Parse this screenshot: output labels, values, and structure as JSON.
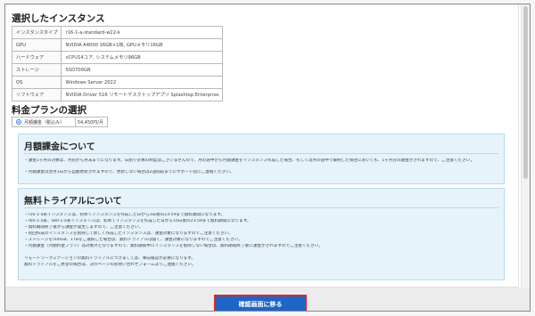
{
  "selected_instance": {
    "title": "選択したインスタンス",
    "rows": [
      {
        "key": "インスタンスタイプ",
        "value": "r16-1-a-standard-w22-k"
      },
      {
        "key": "GPU",
        "value": "NVIDIA A4000 16GB×1枚, GPUメモリ16GB"
      },
      {
        "key": "ハードウェア",
        "value": "vCPU14コア, システムメモリ96GB"
      },
      {
        "key": "ストレージ",
        "value": "SSD700GB"
      },
      {
        "key": "OS",
        "value": "Windows Server 2022"
      },
      {
        "key": "ソフトウェア",
        "value": "NVIDIA Driver 516 リモートデスクトップアプリ Splashtop Enterprise"
      }
    ]
  },
  "plan": {
    "title": "料金プランの選択",
    "option_label": "月額課金（税込み）",
    "option_price": "54,450円/月"
  },
  "monthly_box": {
    "title": "月額課金について",
    "lines": [
      "・課金1ヶ月の対象は、月初から月末までになります。日割り計算の制度はございませんので、月の途中から月額課金をインスタンス作成した場合、もしくは月の途中で解約した場合においても、1ヶ月分の課金がされますので、ご注意ください。",
      "・月額課金は翌月1日から自動更新されますので、更新しない場合は2週間前までにサポート宛にご連絡ください。"
    ]
  },
  "trial_box": {
    "title": "無料トライアルについて",
    "lines": [
      "・r16-1-a系インスタンスは、初めてインスタンスを作成した日から3日後の23:59まで無料期間になります。",
      "・r60-1-a系、s80-1-a系インスタンスは、初めてインスタンスを作成した日から10日後の23:59まで無料期間になります。",
      "・無料期間終了後から課金が発生しますので、ご注意ください。",
      "・初回作成のインスタンスを削除して新しく作成したインスタンスは、課金対象になりますのでご注意ください。",
      "・ストレージを500GB、1TBをご選択した場合は、無料トライアルは無く、課金対象になりますのでご注意ください。",
      "・月額課金（月額料金プラン）は対象外となりますので、無料期間中にインスタンスを削除しない場合は、無料期間終了後に課金がされますのでご注意ください。",
      "",
      "リモートワークステーションの無料トライアルにつきましては、事前確認が必要になります。",
      "無料トライアルをご希望の場合は、次のページのお問い合わせフォームよりご連絡ください。"
    ]
  },
  "confirm_button": "確認画面に移る",
  "colors": {
    "accent": "#1f65c8",
    "highlight_border": "#e0262b",
    "info_box_bg": "#e6f3fb"
  }
}
